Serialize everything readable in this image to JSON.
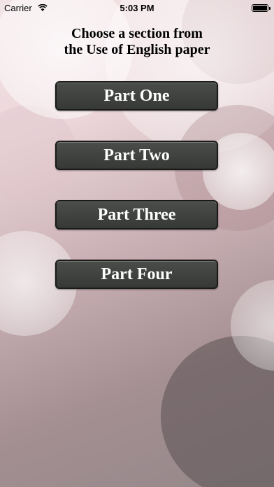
{
  "status_bar": {
    "carrier": "Carrier",
    "time": "5:03 PM"
  },
  "heading": {
    "line1": "Choose a section from",
    "line2": "the Use of English paper"
  },
  "buttons": [
    {
      "label": "Part One"
    },
    {
      "label": "Part Two"
    },
    {
      "label": "Part Three"
    },
    {
      "label": "Part Four"
    }
  ],
  "colors": {
    "button_bg": "#3f423f",
    "button_text": "#ffffff",
    "background": "#d9c2c6"
  }
}
